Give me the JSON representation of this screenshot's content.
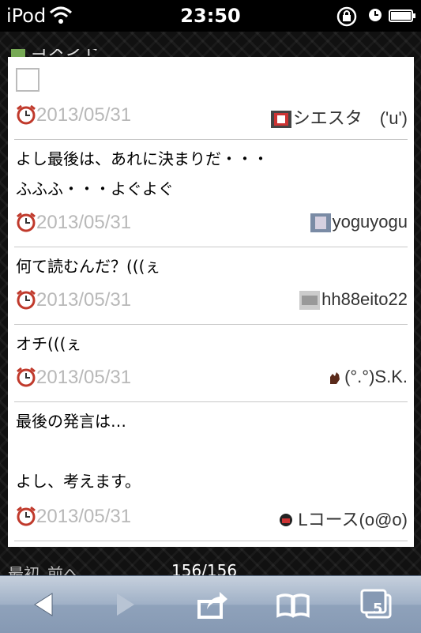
{
  "status_bar": {
    "carrier": "iPod",
    "time": "23:50"
  },
  "section": {
    "title": "コメント"
  },
  "comments": [
    {
      "text_lines": [],
      "date": "2013/05/31",
      "author": "シエスタ　('u')",
      "avatar": "avatar-icon"
    },
    {
      "text_lines": [
        "よし最後は、あれに決まりだ・・・",
        "ふふふ・・・よぐよぐ"
      ],
      "date": "2013/05/31",
      "author": "yoguyogu",
      "avatar": "avatar-icon"
    },
    {
      "text_lines": [
        "何て読むんだ？(((ぇ"
      ],
      "date": "2013/05/31",
      "author": "hh88eito22",
      "avatar": "avatar-icon"
    },
    {
      "text_lines": [
        "オチ(((ぇ"
      ],
      "date": "2013/05/31",
      "author": "(°.°)S.K.",
      "avatar": "hand-icon"
    },
    {
      "text_lines": [
        "最後の発言は…",
        "",
        "よし、考えます。"
      ],
      "date": "2013/05/31",
      "author": "Lコース(o@o)",
      "avatar": "avatar-icon"
    }
  ],
  "pager": {
    "first": "最初",
    "prev": "前へ",
    "count": "156/156"
  },
  "toolbar": {
    "tabs_count": "5",
    "icons": [
      "back-arrow-icon",
      "forward-arrow-icon",
      "share-icon",
      "bookmarks-icon",
      "tabs-icon"
    ]
  },
  "colors": {
    "toolbar": "#9fb0c6",
    "date_text": "#b8b8b8",
    "panel": "#ffffff"
  }
}
